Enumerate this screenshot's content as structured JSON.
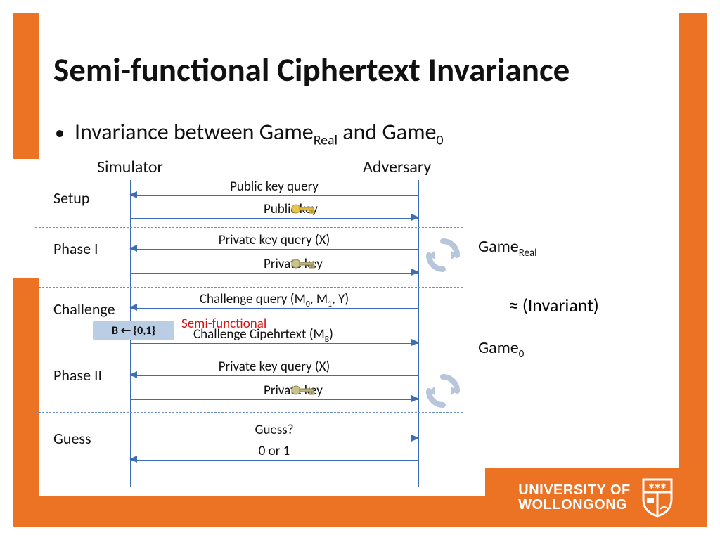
{
  "title": "Semi-functional Ciphertext Invariance",
  "bullet_prefix": "Invariance between Game",
  "bullet_sub1": "Real",
  "bullet_mid": " and Game",
  "bullet_sub2": "0",
  "columns": {
    "simulator": "Simulator",
    "adversary": "Adversary"
  },
  "phases": {
    "setup": "Setup",
    "phase1": "Phase I",
    "challenge": "Challenge",
    "phase2": "Phase II",
    "guess": "Guess"
  },
  "messages": {
    "pk_query": "Public key query",
    "pk_reply": "Public key",
    "sk_query1": "Private key query (X)",
    "sk_reply1": "Private key",
    "ch_query_pre": "Challenge query (M",
    "ch_query_s0": "0",
    "ch_query_mid": ", M",
    "ch_query_s1": "1",
    "ch_query_post": ", Y)",
    "semi_func": "Semi-functional",
    "ch_reply_pre": "Challenge Cipehrtext (M",
    "ch_reply_sub": "B",
    "ch_reply_post": ")",
    "sk_query2": "Private key query (X)",
    "sk_reply2": "Private key",
    "guess_q": "Guess?",
    "guess_r": "0 or 1"
  },
  "b_label": "B ← {0,1}",
  "games": {
    "real_pre": "Game",
    "real_sub": "Real",
    "inv": "(Invariant)",
    "approx": "≈",
    "zero_pre": "Game",
    "zero_sub": "0"
  },
  "footer": {
    "line1": "UNIVERSITY OF",
    "line2": "WOLLONGONG"
  }
}
